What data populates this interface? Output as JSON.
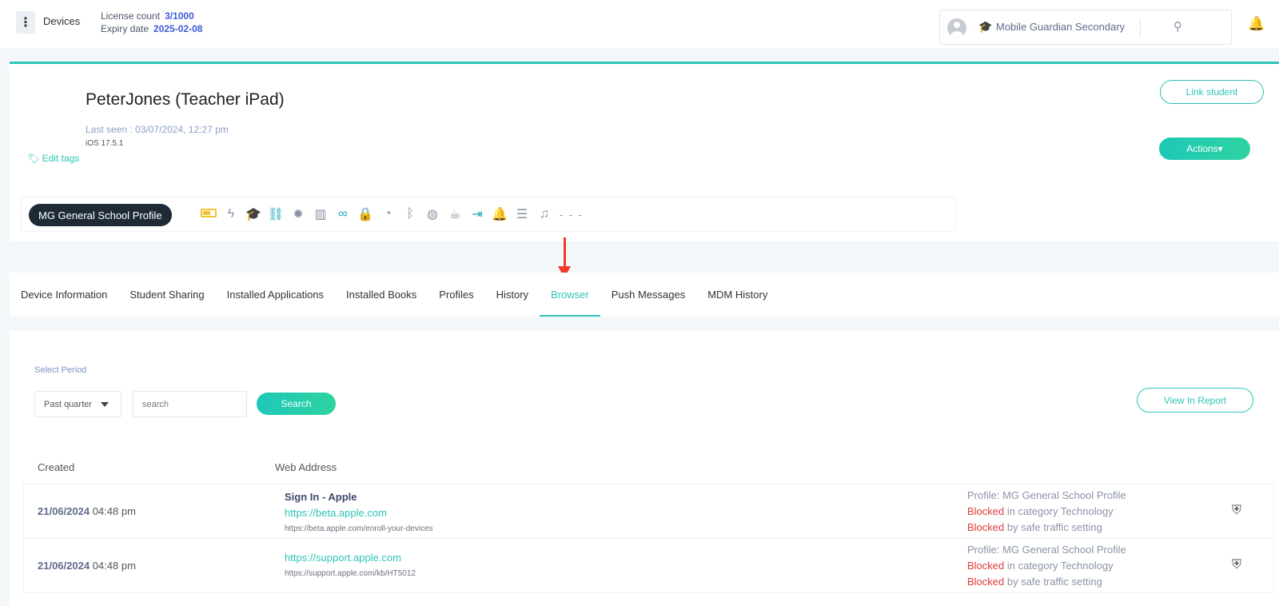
{
  "topbar": {
    "devices_label": "Devices",
    "license_label": "License count",
    "license_value": "3/1000",
    "expiry_label": "Expiry date",
    "expiry_value": "2025-02-08",
    "account_name": "Mobile Guardian Secondary"
  },
  "device": {
    "name": "PeterJones (Teacher iPad)",
    "last_seen": "Last seen : 03/07/2024, 12:27 pm",
    "os_version": "iOS 17.5.1",
    "edit_tags": "Edit tags",
    "link_student": "Link student",
    "profile": "MG General School Profile",
    "actions": "Actions"
  },
  "tabs": [
    {
      "label": "Device Information"
    },
    {
      "label": "Student Sharing"
    },
    {
      "label": "Installed Applications"
    },
    {
      "label": "Installed Books"
    },
    {
      "label": "Profiles"
    },
    {
      "label": "History"
    },
    {
      "label": "Browser",
      "active": true
    },
    {
      "label": "Push Messages"
    },
    {
      "label": "MDM History"
    }
  ],
  "browser": {
    "select_period": "Select Period",
    "period_value": "Past quarter",
    "search_placeholder": "search",
    "search_button": "Search",
    "view_report": "View In Report",
    "headers": {
      "created": "Created",
      "web_address": "Web Address"
    },
    "rows": [
      {
        "date": "21/06/2024",
        "time": "04:48 pm",
        "title": "Sign In - Apple",
        "url": "https://beta.apple.com",
        "full_url": "https://beta.apple.com/enroll-your-devices",
        "profile": "Profile: MG General School Profile",
        "blocked1": "Blocked",
        "reason1": " in category Technology",
        "blocked2": "Blocked",
        "reason2": " by safe traffic setting"
      },
      {
        "date": "21/06/2024",
        "time": "04:48 pm",
        "title": "",
        "url": "https://support.apple.com",
        "full_url": "https://support.apple.com/kb/HT5012",
        "profile": "Profile: MG General School Profile",
        "blocked1": "Blocked",
        "reason1": " in category Technology",
        "blocked2": "Blocked",
        "reason2": " by safe traffic setting"
      }
    ]
  },
  "colors": {
    "accent": "#2ec4b6",
    "blocked": "#e03b3b",
    "dark_pill": "#1f2a37",
    "arrow": "#f03a2a"
  }
}
